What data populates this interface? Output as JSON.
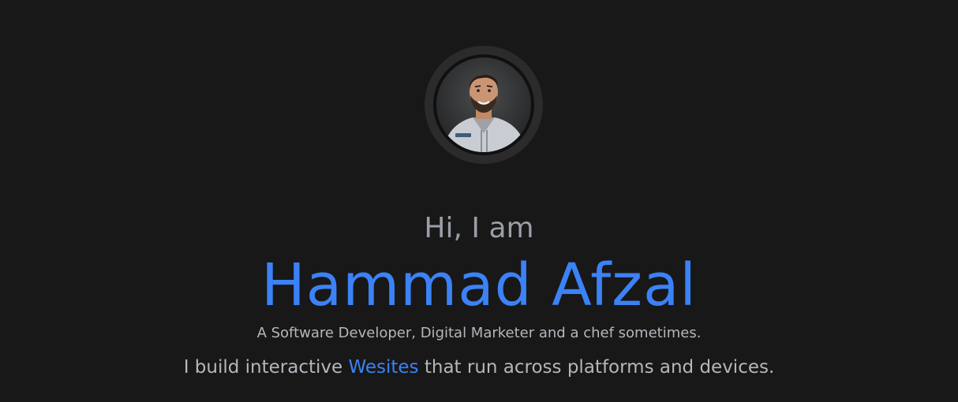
{
  "hero": {
    "avatar_alt": "Profile photo",
    "greeting": "Hi, I am",
    "name": "Hammad Afzal",
    "subtitle": "A Software Developer, Digital Marketer and a chef sometimes.",
    "tagline_prefix": "I build interactive ",
    "tagline_highlight": "Wesites",
    "tagline_suffix": " that run across platforms and devices."
  },
  "colors": {
    "background": "#181818",
    "accent": "#3b82f6",
    "muted_text": "#9a9ea6",
    "body_text": "#b3b7bd",
    "avatar_ring": "#2b2b2b"
  }
}
